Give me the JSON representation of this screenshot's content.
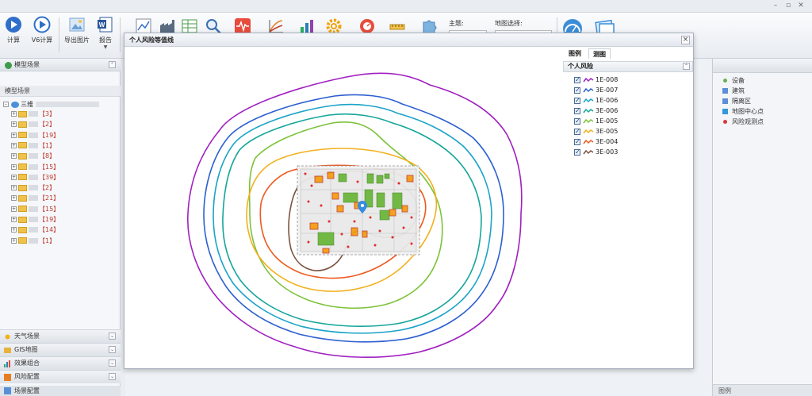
{
  "window": {
    "title": ""
  },
  "ribbon": {
    "calc_label": "计算",
    "v6calc_label": "V6计算",
    "export_label": "导出图片",
    "report_label": "报告",
    "theme_label": "主题:",
    "map_select_label": "地图选择:"
  },
  "left_panel": {
    "title": "模型场景",
    "subheader": "模型场景",
    "tree_root": "三维",
    "tree_items": [
      {
        "count": "【3】"
      },
      {
        "count": "【2】"
      },
      {
        "count": "【19】"
      },
      {
        "count": "【1】"
      },
      {
        "count": "【8】"
      },
      {
        "count": "【15】"
      },
      {
        "count": "【39】"
      },
      {
        "count": "【2】"
      },
      {
        "count": "【21】"
      },
      {
        "count": "【15】"
      },
      {
        "count": "【19】"
      },
      {
        "count": "【14】"
      },
      {
        "count": "【1】"
      }
    ],
    "accordion": [
      "天气场景",
      "GIS地图",
      "效果组合",
      "风险配置"
    ],
    "bottom_tab": "场景配置"
  },
  "dialog": {
    "title": "个人风险等值线",
    "tabs": [
      "图例",
      "测图"
    ],
    "group_title": "个人风险",
    "contours": [
      {
        "label": "1E-008",
        "color": "#a020c0"
      },
      {
        "label": "3E-007",
        "color": "#2c5fd0"
      },
      {
        "label": "1E-006",
        "color": "#1aa3c8"
      },
      {
        "label": "3E-006",
        "color": "#15a59a"
      },
      {
        "label": "1E-005",
        "color": "#7cc23a"
      },
      {
        "label": "3E-005",
        "color": "#f2b01e"
      },
      {
        "label": "3E-004",
        "color": "#ee5a1e"
      },
      {
        "label": "3E-003",
        "color": "#7a5240"
      }
    ]
  },
  "right_panel": {
    "legend": [
      {
        "label": "设备",
        "icon": "dot-icon",
        "color": "#6ab04c"
      },
      {
        "label": "建筑",
        "icon": "building-icon",
        "color": "#5b8fd6"
      },
      {
        "label": "隔离区",
        "icon": "zone-icon",
        "color": "#5b8fd6"
      },
      {
        "label": "地图中心点",
        "icon": "pin-icon",
        "color": "#3498db"
      },
      {
        "label": "风险观测点",
        "icon": "dot-icon",
        "color": "#d83a3a"
      }
    ],
    "footer": "图例"
  }
}
